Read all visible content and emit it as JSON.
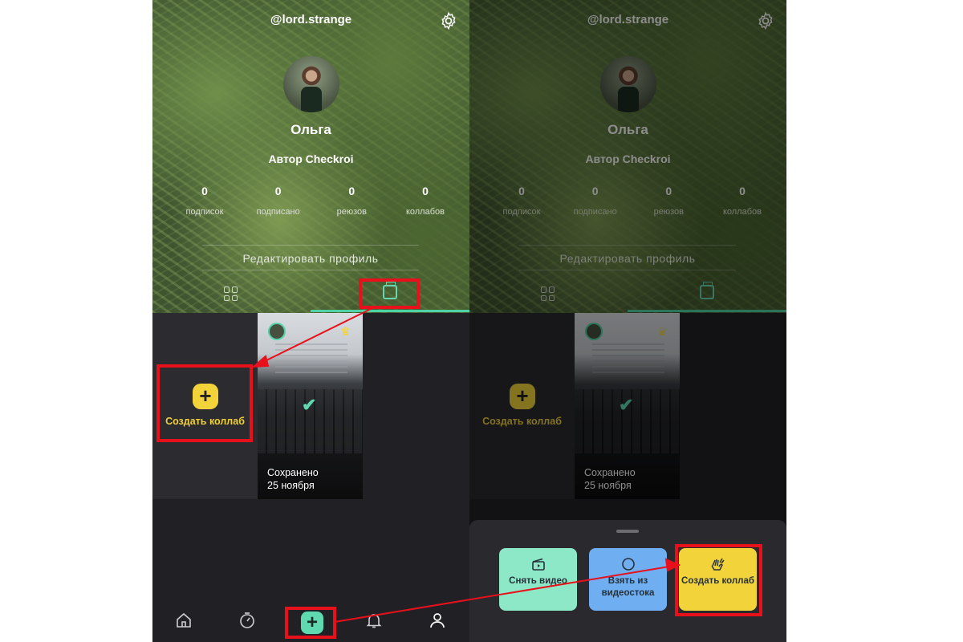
{
  "profile": {
    "handle": "@lord.strange",
    "name": "Ольга",
    "role": "Автор Checkroi",
    "stats": [
      {
        "value": "0",
        "label": "подписок"
      },
      {
        "value": "0",
        "label": "подписано"
      },
      {
        "value": "0",
        "label": "реюзов"
      },
      {
        "value": "0",
        "label": "коллабов"
      }
    ],
    "edit_button": "Редактировать профиль"
  },
  "grid": {
    "create_label": "Создать коллаб",
    "saved_status": "Сохранено",
    "saved_date": "25 ноября"
  },
  "sheet": {
    "film_label": "Снять видео",
    "stock_label": "Взять из видеостока",
    "collab_label": "Создать коллаб"
  },
  "icons": [
    "gear-icon",
    "grid-icon",
    "collab-tab-icon",
    "plus-icon",
    "check-icon",
    "crown-icon",
    "home-icon",
    "timer-icon",
    "bell-icon",
    "profile-icon",
    "clapper-icon",
    "circle-icon",
    "hands-icon"
  ],
  "colors": {
    "accent_green": "#4fd3a6",
    "accent_yellow": "#f2d33a",
    "accent_blue": "#6faef1",
    "highlight_red": "#e8101a",
    "background": "#212125"
  }
}
